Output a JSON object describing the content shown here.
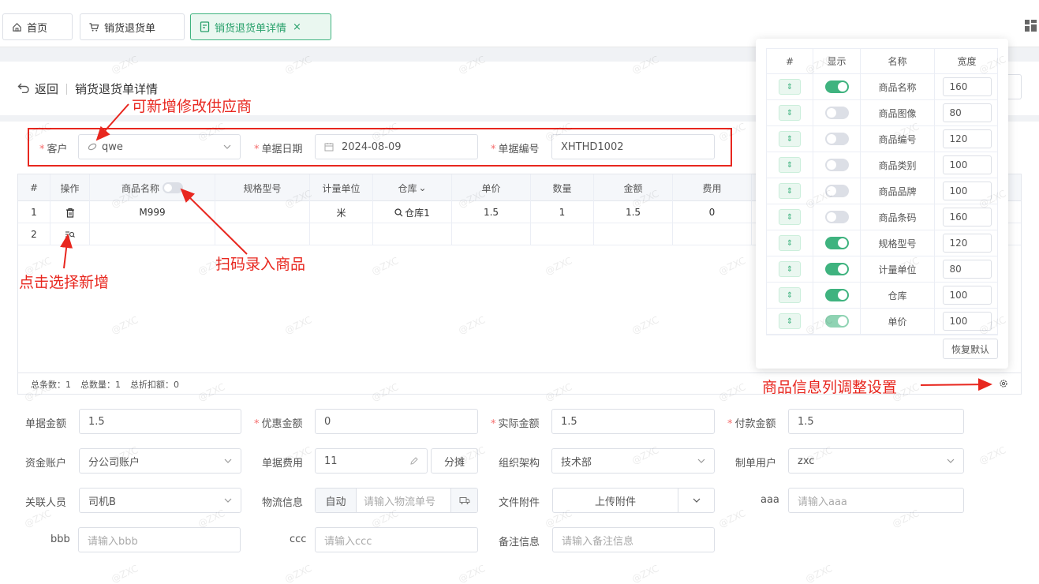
{
  "tabs": [
    {
      "label": "首页",
      "icon": "home-icon"
    },
    {
      "label": "销货退货单",
      "icon": "cart-icon"
    },
    {
      "label": "销货退货单详情",
      "icon": "document-icon",
      "close": "×"
    }
  ],
  "header": {
    "back": "返回",
    "title": "销货退货单详情"
  },
  "annotations": {
    "supplier": "可新增修改供应商",
    "scan": "扫码录入商品",
    "click_add": "点击选择新增",
    "column_settings": "商品信息列调整设置"
  },
  "top_form": {
    "customer_label": "客户",
    "customer_value": "qwe",
    "date_label": "单据日期",
    "date_value": "2024-08-09",
    "number_label": "单据编号",
    "number_value": "XHTHD1002"
  },
  "table": {
    "headers": [
      "#",
      "操作",
      "商品名称",
      "规格型号",
      "计量单位",
      "仓库",
      "单价",
      "数量",
      "金额",
      "费用"
    ],
    "warehouse_suffix": "⌄",
    "rows": [
      {
        "index": "1",
        "name": "M999",
        "spec": "",
        "unit": "米",
        "warehouse": "仓库1",
        "price": "1.5",
        "qty": "1",
        "amount": "1.5",
        "fee": "0"
      },
      {
        "index": "2",
        "name": "",
        "spec": "",
        "unit": "",
        "warehouse": "",
        "price": "",
        "qty": "",
        "amount": "",
        "fee": ""
      }
    ],
    "footer": {
      "total_count": "总条数：1",
      "total_qty": "总数量：1",
      "total_discount": "总折扣额：0"
    }
  },
  "column_popover": {
    "headers": [
      "#",
      "显示",
      "名称",
      "宽度"
    ],
    "rows": [
      {
        "name": "商品名称",
        "show": true,
        "width": "160"
      },
      {
        "name": "商品图像",
        "show": false,
        "width": "80"
      },
      {
        "name": "商品编号",
        "show": false,
        "width": "120"
      },
      {
        "name": "商品类别",
        "show": false,
        "width": "100"
      },
      {
        "name": "商品品牌",
        "show": false,
        "width": "100"
      },
      {
        "name": "商品条码",
        "show": false,
        "width": "160"
      },
      {
        "name": "规格型号",
        "show": true,
        "width": "120"
      },
      {
        "name": "计量单位",
        "show": true,
        "width": "80"
      },
      {
        "name": "仓库",
        "show": true,
        "width": "100"
      },
      {
        "name": "单价",
        "show": true,
        "width": "100"
      }
    ],
    "reset": "恢复默认"
  },
  "bottom_form": {
    "bill_amount_label": "单据金额",
    "bill_amount": "1.5",
    "discount_label": "优惠金额",
    "discount": "0",
    "actual_label": "实际金额",
    "actual": "1.5",
    "paid_label": "付款金额",
    "paid": "1.5",
    "account_label": "资金账户",
    "account": "分公司账户",
    "fee_label": "单据费用",
    "fee": "11",
    "split": "分摊",
    "org_label": "组织架构",
    "org": "技术部",
    "creator_label": "制单用户",
    "creator": "zxc",
    "person_label": "关联人员",
    "person": "司机B",
    "logistics_label": "物流信息",
    "logistics_auto": "自动",
    "logistics_ph": "请输入物流单号",
    "attach_label": "文件附件",
    "attach_btn": "上传附件",
    "aaa_label": "aaa",
    "aaa_ph": "请输入aaa",
    "bbb_label": "bbb",
    "bbb_ph": "请输入bbb",
    "ccc_label": "ccc",
    "ccc_ph": "请输入ccc",
    "remark_label": "备注信息",
    "remark_ph": "请输入备注信息"
  },
  "watermark": "@ZXC",
  "colors": {
    "accent": "#3fb37f",
    "annotation": "#e8271f",
    "required": "#f56c6c"
  }
}
